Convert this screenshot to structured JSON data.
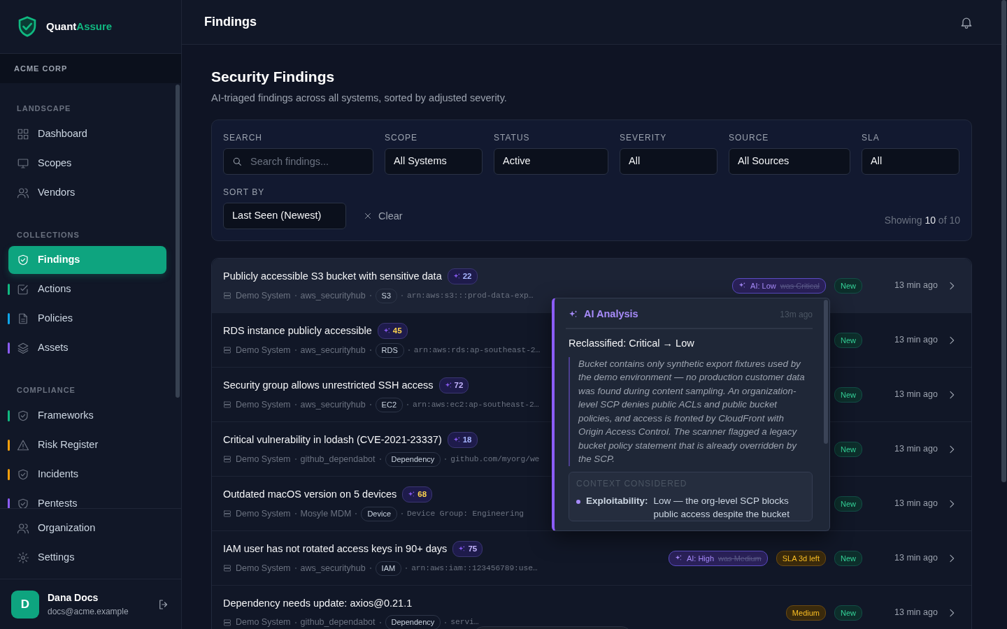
{
  "sidebar": {
    "brand": {
      "first": "Quant",
      "second": "Assure"
    },
    "org": "ACME CORP",
    "sections": [
      {
        "title": "LANDSCAPE",
        "items": [
          {
            "label": "Dashboard",
            "selected": false
          },
          {
            "label": "Scopes",
            "selected": false
          },
          {
            "label": "Vendors",
            "selected": false
          }
        ]
      },
      {
        "title": "COLLECTIONS",
        "items": [
          {
            "label": "Findings",
            "selected": true
          },
          {
            "label": "Actions",
            "selected": false,
            "color": "#10b981"
          },
          {
            "label": "Policies",
            "selected": false,
            "color": "#0ea5e9"
          },
          {
            "label": "Assets",
            "selected": false,
            "color": "#8b5cf6"
          }
        ]
      },
      {
        "title": "COMPLIANCE",
        "items": [
          {
            "label": "Frameworks",
            "selected": false,
            "color": "#10b981"
          },
          {
            "label": "Risk Register",
            "selected": false,
            "color": "#f59e0b"
          },
          {
            "label": "Incidents",
            "selected": false,
            "color": "#f59e0b"
          },
          {
            "label": "Pentests",
            "selected": false,
            "color": "#8b5cf6"
          }
        ]
      }
    ],
    "footer_items": [
      {
        "label": "Organization",
        "selected": false
      },
      {
        "label": "Settings",
        "selected": false
      }
    ],
    "user": {
      "initial": "D",
      "name": "Dana Docs",
      "email": "docs@acme.example"
    }
  },
  "header": {
    "title": "Findings"
  },
  "page": {
    "title": "Security Findings",
    "subtitle": "AI-triaged findings across all systems, sorted by adjusted severity."
  },
  "filters": [
    {
      "kind": "search",
      "label": "SEARCH",
      "placeholder": "Search findings..."
    },
    {
      "kind": "select",
      "label": "SCOPE",
      "value": "All Systems"
    },
    {
      "kind": "select",
      "label": "STATUS",
      "value": "Active"
    },
    {
      "kind": "select",
      "label": "SEVERITY",
      "value": "All"
    },
    {
      "kind": "select",
      "label": "SOURCE",
      "value": "All Sources"
    },
    {
      "kind": "select",
      "label": "SLA",
      "value": "All"
    }
  ],
  "sort": {
    "label": "SORT BY",
    "value": "Last Seen (Newest)"
  },
  "clear": "Clear",
  "showing": {
    "prefix": "Showing",
    "count": "10",
    "suffix": "of 10"
  },
  "findings": [
    {
      "title": "Publicly accessible S3 bucket with sensitive data",
      "score": "22",
      "color": "#a5b4fc",
      "system": "Demo System",
      "source": "aws_securityhub",
      "type": "S3",
      "resource": "arn:aws:s3:::prod-data-exp…",
      "ai": {
        "label": "AI: Low",
        "was": "was Critical"
      },
      "status": "New",
      "time": "13 min ago",
      "selected": true
    },
    {
      "title": "RDS instance publicly accessible",
      "score": "45",
      "color": "#fcd34d",
      "system": "Demo System",
      "source": "aws_securityhub",
      "type": "RDS",
      "resource": "arn:aws:rds:ap-southeast-2…",
      "status": "New",
      "time": "13 min ago",
      "selected": false
    },
    {
      "title": "Security group allows unrestricted SSH access",
      "score": "72",
      "color": "#c4b5fd",
      "system": "Demo System",
      "source": "aws_securityhub",
      "type": "EC2",
      "resource": "arn:aws:ec2:ap-southeast-2…",
      "status": "New",
      "time": "13 min ago",
      "selected": false
    },
    {
      "title": "Critical vulnerability in lodash (CVE-2021-23337)",
      "score": "18",
      "color": "#a5b4fc",
      "system": "Demo System",
      "source": "github_dependabot",
      "type": "Dependency",
      "resource": "github.com/myorg/we",
      "status": "New",
      "time": "13 min ago",
      "selected": false
    },
    {
      "title": "Outdated macOS version on 5 devices",
      "score": "68",
      "color": "#fcd34d",
      "system": "Demo System",
      "source": "Mosyle MDM",
      "type": "Device",
      "resource": "Device Group: Engineering",
      "status": "New",
      "time": "13 min ago",
      "selected": false
    },
    {
      "title": "IAM user has not rotated access keys in 90+ days",
      "score": "75",
      "color": "#c4b5fd",
      "system": "Demo System",
      "source": "aws_securityhub",
      "type": "IAM",
      "resource": "arn:aws:iam::123456789:use…",
      "ai": {
        "label": "AI: High",
        "was": "was Medium"
      },
      "sla": "SLA 3d left",
      "status": "New",
      "time": "13 min ago",
      "selected": false
    },
    {
      "title": "Dependency needs update: axios@0.21.1",
      "system": "Demo System",
      "source": "github_dependabot",
      "type": "Dependency",
      "resource": "servi…",
      "severity": "Medium",
      "status": "New",
      "time": "13 min ago",
      "selected": false
    }
  ],
  "analysis": {
    "title": "AI Analysis",
    "time": "13m ago",
    "heading": "Reclassified: Critical → Low",
    "reason": "Bucket contains only synthetic export fixtures used by the demo environment — no production customer data was found during content sampling. An organization-level SCP denies public ACLs and public bucket policies, and access is fronted by CloudFront with Origin Access Control. The scanner flagged a legacy bucket policy statement that is already overridden by the SCP.",
    "context_title": "CONTEXT CONSIDERED",
    "context": [
      {
        "label": "Exploitability:",
        "value": "Low — the org-level SCP blocks public access despite the bucket"
      }
    ]
  }
}
